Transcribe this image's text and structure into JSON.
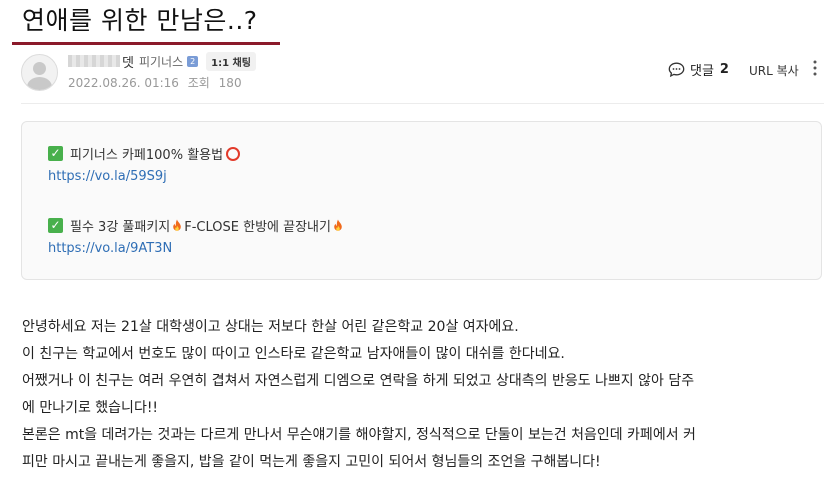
{
  "post": {
    "title": "연애를 위한 만남은..?",
    "author_name_suffix": "뎃",
    "author_grade": "피기너스",
    "grade_badge_text": "2",
    "chat_badge": "1:1 채팅",
    "date": "2022.08.26. 01:16",
    "views_label": "조회",
    "views": "180"
  },
  "actions": {
    "comment_label": "댓글",
    "comment_count": "2",
    "url_copy": "URL 복사"
  },
  "promo": {
    "item1_text": "피기너스 카페100% 활용법",
    "item1_link": "https://vo.la/59S9j",
    "item2_text_a": "필수 3강 풀패키지",
    "item2_text_b": "F-CLOSE 한방에 끝장내기",
    "item2_link": "https://vo.la/9AT3N",
    "check_color": "#48b04c",
    "link_color": "#2f6eb5"
  },
  "body_lines": [
    " 안녕하세요 저는 21살 대학생이고 상대는 저보다 한살 어린 같은학교 20살 여자에요.",
    " 이 친구는 학교에서 번호도 많이 따이고 인스타로 같은학교 남자애들이 많이 대쉬를 한다네요.",
    " 어쨌거나 이 친구는 여러 우연히 겹쳐서 자연스럽게 디엠으로 연락을 하게 되었고 상대측의 반응도 나쁘지 않아 담주",
    "에 만나기로 했습니다!!",
    " 본론은 mt을 데려가는 것과는 다르게 만나서 무슨얘기를 해야할지, 정식적으로 단둘이 보는건 처음인데 카페에서 커",
    "피만 마시고 끝내는게 좋을지, 밥을 같이 먹는게 좋을지 고민이 되어서 형님들의 조언을 구해봅니다!"
  ],
  "colors": {
    "title_underline": "#8b1a2a"
  }
}
